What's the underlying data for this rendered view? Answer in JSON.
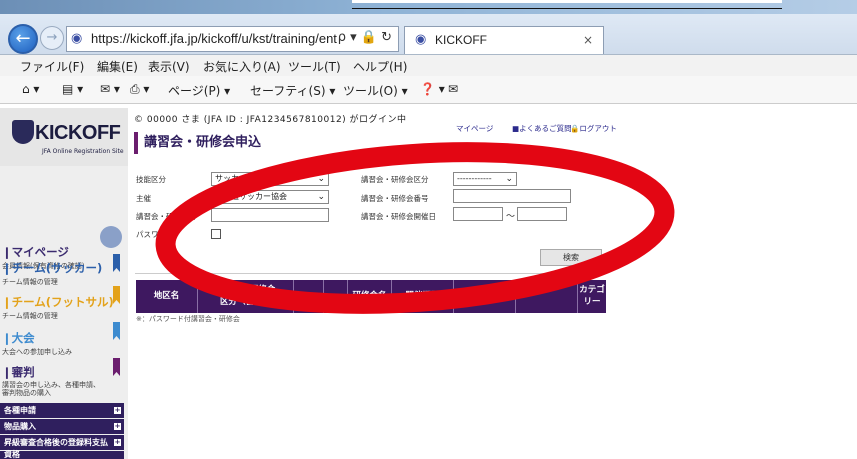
{
  "browser": {
    "address_url": "https://kickoff.jfa.jp/kickoff/u/kst/training/ent",
    "address_tools": "ρ ▾ 🔒 ↻",
    "tab_title": "KICKOFF",
    "tab_close": "×",
    "back_glyph": "←",
    "forward_glyph": "→",
    "menu": [
      "ファイル(F)",
      "編集(E)",
      "表示(V)",
      "お気に入り(A)",
      "ツール(T)",
      "ヘルプ(H)"
    ],
    "commands": [
      "⌂ ▾",
      "▤ ▾",
      "✉ ▾",
      "⎙ ▾",
      "ページ(P) ▾",
      "セーフティ(S) ▾",
      "ツール(O) ▾",
      "❓ ▾",
      "✉"
    ]
  },
  "site": {
    "logo": "KICKOFF",
    "logo_sub": "JFA Online Registration Site",
    "user_line": "© 00000 さま (JFA ID : JFA1234567810012) がログイン中",
    "top_links": [
      "マイページ",
      "■よくあるご質問",
      "🔒ログアウト"
    ],
    "page_title": "講習会・研修会申込"
  },
  "sidebar": {
    "sections": [
      {
        "title": "❙マイページ",
        "sub": "会員情報(保有資格の確認)",
        "color": "#2f1f5e"
      },
      {
        "title": "❙チーム(サッカー)",
        "sub": "チーム情報の管理",
        "color": "#2b5faa"
      },
      {
        "title": "❙チーム(フットサル)",
        "sub": "チーム情報の管理",
        "color": "#e3a21a"
      },
      {
        "title": "❙大会",
        "sub": "大会への参加申し込み",
        "color": "#3d8bcf"
      },
      {
        "title": "❙審判",
        "sub": "講習会の申し込み、各種申請、審判物品の購入",
        "color": "#6b1e6e"
      }
    ],
    "dark_items": [
      "各種申請",
      "物品購入",
      "昇級審査合格後の登録料支払",
      "資格"
    ]
  },
  "form": {
    "labels": {
      "skill_area": "技能区分",
      "sponsor": "主催",
      "name": "講習会・研修会名",
      "password": "パスワード",
      "category": "講習会・研修会区分",
      "number": "講習会・研修会番号",
      "date": "講習会・研修会開催日"
    },
    "skill_area_value": "サッカー審判",
    "sponsor_value": "北海道サッカー協会",
    "category_value": "------------",
    "date_sep": "〜",
    "search_label": "検索"
  },
  "table": {
    "headers": [
      "地区名",
      "講習会・研修会\n区分（番号）",
      "",
      "",
      "研修会名",
      "開催期間",
      "",
      "",
      "カテゴ\nリー"
    ]
  },
  "note": "※：パスワード付講習会・研修会",
  "colors": {
    "annotation_ring": "#e30613",
    "table_header": "#3e1860"
  }
}
